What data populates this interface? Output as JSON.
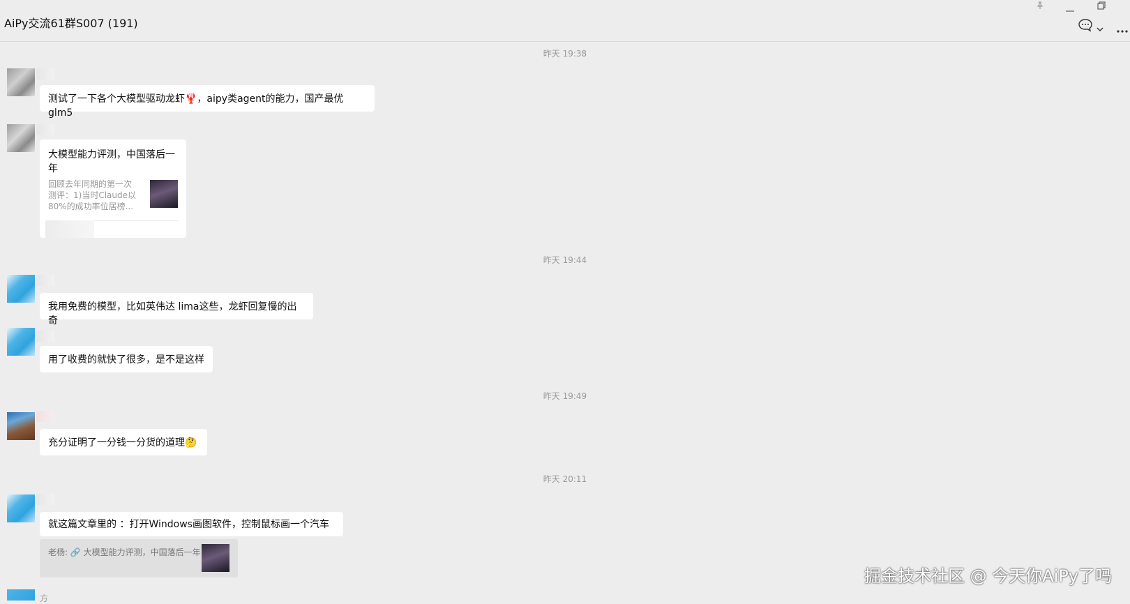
{
  "header": {
    "title": "AiPy交流61群S007 (191)",
    "pin_icon": "pin-icon",
    "minimize_icon": "minimize-icon",
    "maximize_icon": "restore-icon",
    "chat_icon": "chat-bubble-icon",
    "more_icon": "more-icon"
  },
  "messages": {
    "ts1": "昨天 19:38",
    "m1": "测试了一下各个大模型驱动龙虾🦞，aipy类agent的能力，国产最优glm5",
    "card": {
      "title": "大模型能力评测，中国落后一年",
      "desc": "回顾去年同期的第一次测评：1)当时Claude以80%的成功率位居榜..."
    },
    "ts2": "昨天 19:44",
    "m2": "我用免费的模型，比如英伟达 lima这些，龙虾回复慢的出奇",
    "m3": "用了收费的就快了很多，是不是这样",
    "ts3": "昨天 19:49",
    "m4": "充分证明了一分钱一分货的道理🤔",
    "ts4": "昨天 20:11",
    "m5": "就这篇文章里的  ：打开Windows画图软件，控制鼠标画一个汽车",
    "quote": "老杨: 🔗 大模型能力评测，中国落后一年",
    "last_sender": "方"
  },
  "watermark": "掘金技术社区 @ 今天你AiPy了吗",
  "colors": {
    "background": "#ededed",
    "bubble": "#ffffff",
    "timestamp": "#9a9a9a"
  }
}
